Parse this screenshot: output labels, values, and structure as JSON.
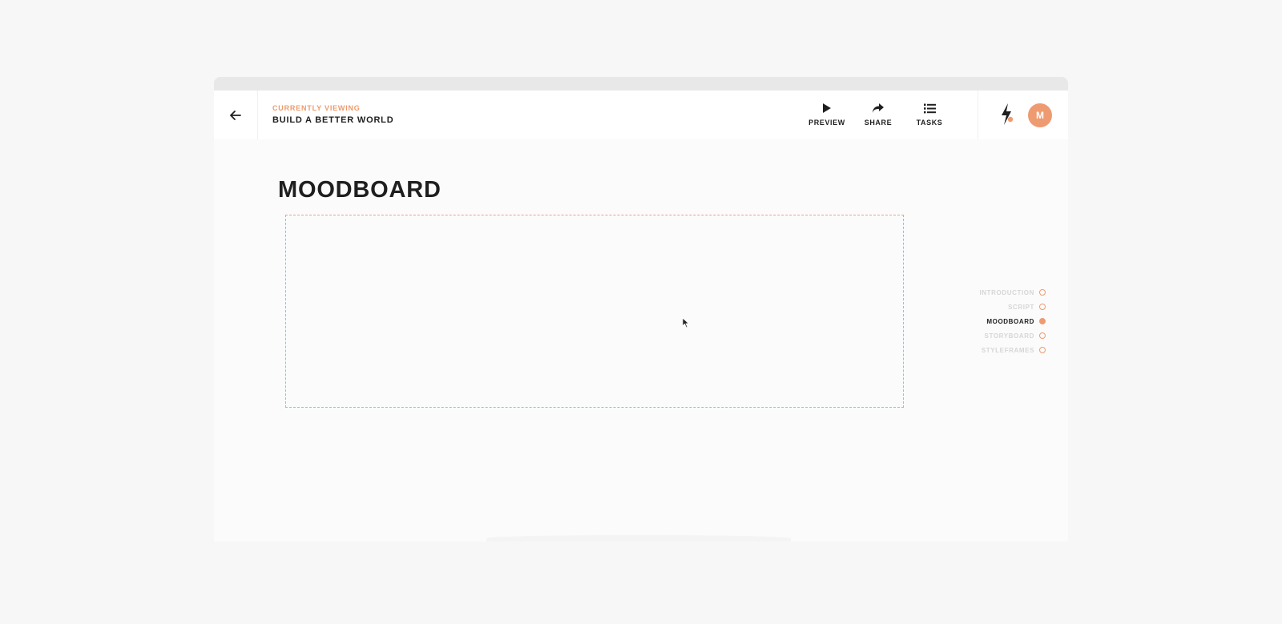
{
  "header": {
    "eyebrow": "CURRENTLY VIEWING",
    "project_title": "BUILD A BETTER WORLD"
  },
  "actions": [
    {
      "label": "PREVIEW",
      "icon": "play-icon"
    },
    {
      "label": "SHARE",
      "icon": "share-icon"
    },
    {
      "label": "TASKS",
      "icon": "list-icon"
    }
  ],
  "user": {
    "initial": "M"
  },
  "main": {
    "title": "MOODBOARD"
  },
  "section_nav": [
    {
      "label": "INTRODUCTION",
      "active": false
    },
    {
      "label": "SCRIPT",
      "active": false
    },
    {
      "label": "MOODBOARD",
      "active": true
    },
    {
      "label": "STORYBOARD",
      "active": false
    },
    {
      "label": "STYLEFRAMES",
      "active": false
    }
  ],
  "colors": {
    "accent": "#ee9b72",
    "text": "#1f1f1f",
    "muted": "#d6d6d6",
    "background": "#fbfbfb"
  }
}
